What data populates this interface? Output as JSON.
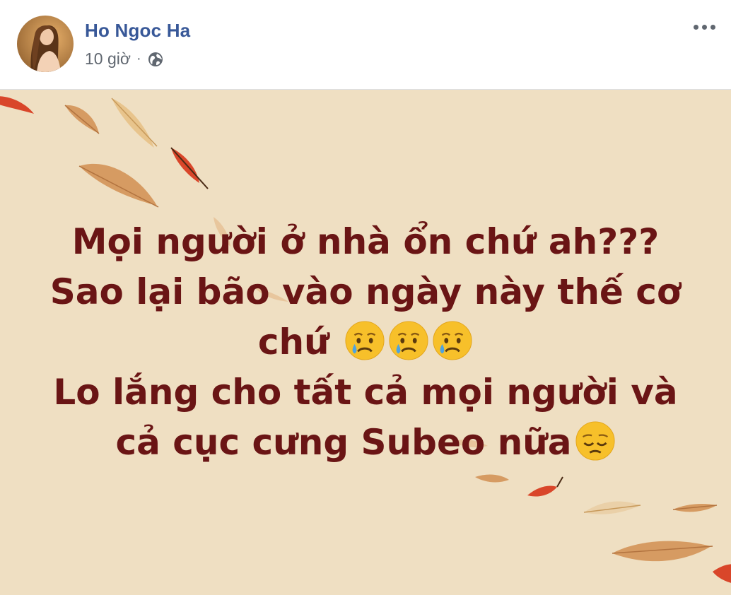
{
  "post": {
    "author": "Ho Ngoc Ha",
    "time": "10 giờ",
    "separator": "·",
    "privacy_icon": "globe-icon",
    "more_icon": "more-options-icon"
  },
  "message": {
    "line1": "Mọi người ở nhà ổn chứ ah???",
    "line2": "Sao lại bão vào ngày này thế cơ",
    "line3": "chứ",
    "line4": "Lo lắng cho tất cả mọi người và",
    "line5": "cả cục cưng Subeo nữa",
    "line3_emojis": [
      "crying-face-emoji",
      "crying-face-emoji",
      "crying-face-emoji"
    ],
    "line5_emoji": "pensive-face-emoji"
  },
  "colors": {
    "author": "#385898",
    "meta": "#606770",
    "background": "#efdfc2",
    "text": "#6a1515",
    "leaf_red": "#d9462a",
    "leaf_tan": "#d69b62"
  }
}
